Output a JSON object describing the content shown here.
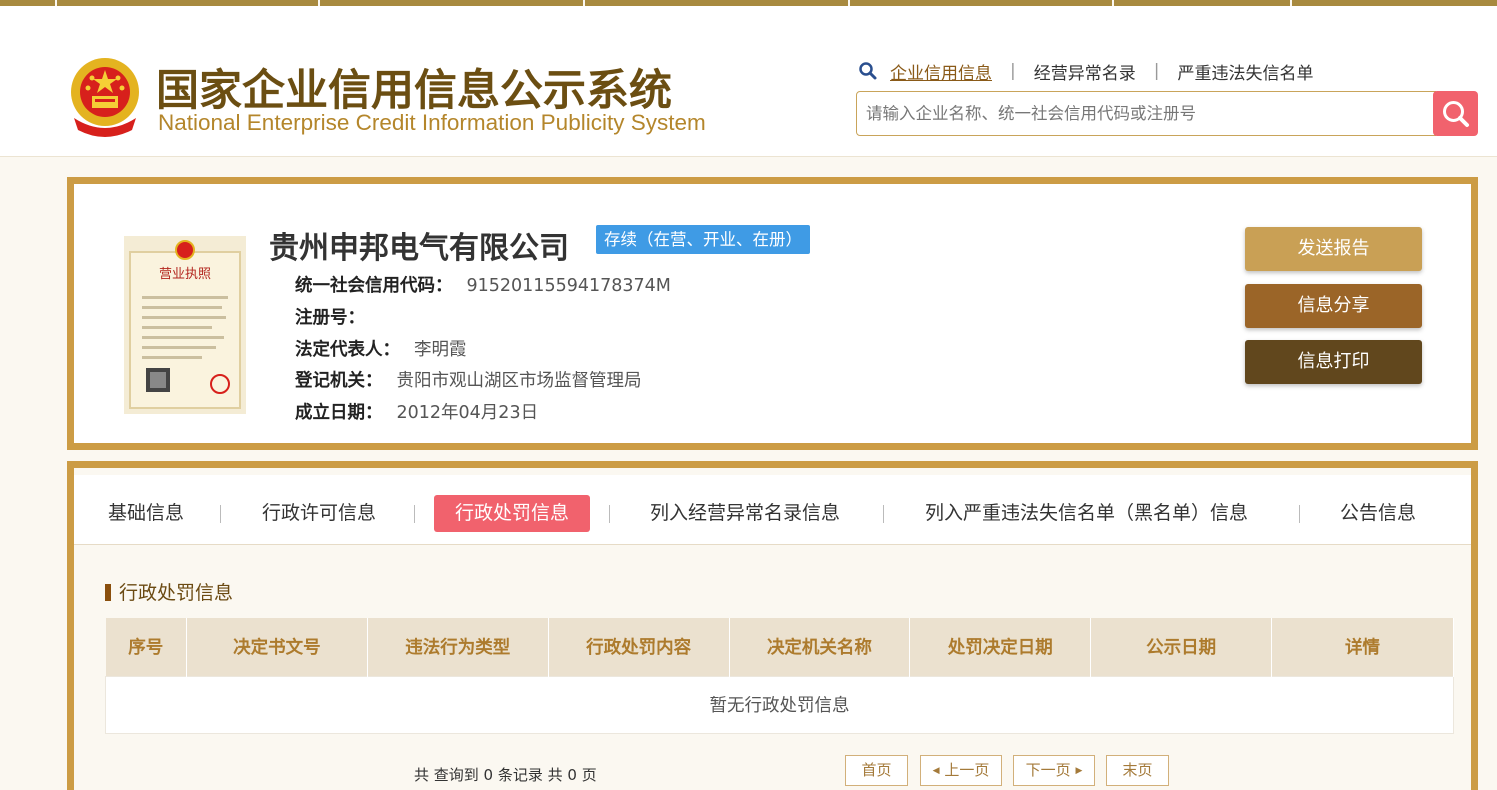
{
  "header": {
    "logo_cn": "国家企业信用信息公示系统",
    "logo_en": "National Enterprise Credit Information Publicity System",
    "search_tabs": [
      "企业信用信息",
      "经营异常名录",
      "严重违法失信名单"
    ],
    "search_placeholder": "请输入企业名称、统一社会信用代码或注册号"
  },
  "company": {
    "name": "贵州申邦电气有限公司",
    "status": "存续（在营、开业、在册）",
    "fields": [
      {
        "label": "统一社会信用代码：",
        "value": "9152011559417837​4M"
      },
      {
        "label": "注册号：",
        "value": ""
      },
      {
        "label": "法定代表人：",
        "value": "李明霞"
      },
      {
        "label": "登记机关：",
        "value": "贵阳市观山湖区市场监督管理局"
      },
      {
        "label": "成立日期：",
        "value": "2012年04月23日"
      }
    ],
    "buttons": {
      "report": "发送报告",
      "share": "信息分享",
      "print": "信息打印"
    },
    "license_title": "营业执照"
  },
  "tabs": [
    "基础信息",
    "行政许可信息",
    "行政处罚信息",
    "列入经营异常名录信息",
    "列入严重违法失信名单（黑名单）信息",
    "公告信息"
  ],
  "section": {
    "title": "行政处罚信息",
    "columns": [
      "序号",
      "决定书文号",
      "违法行为类型",
      "行政处罚内容",
      "决定机关名称",
      "处罚决定日期",
      "公示日期",
      "详情"
    ],
    "empty_text": "暂无行政处罚信息"
  },
  "pager": {
    "summary": "共 查询到 0 条记录 共 0 页",
    "first": "首页",
    "prev": "上一页",
    "next": "下一页",
    "last": "末页"
  },
  "colors": {
    "accent_gold": "#cc9c45",
    "active_tab": "#f1626d",
    "status_badge": "#3f9be5"
  }
}
